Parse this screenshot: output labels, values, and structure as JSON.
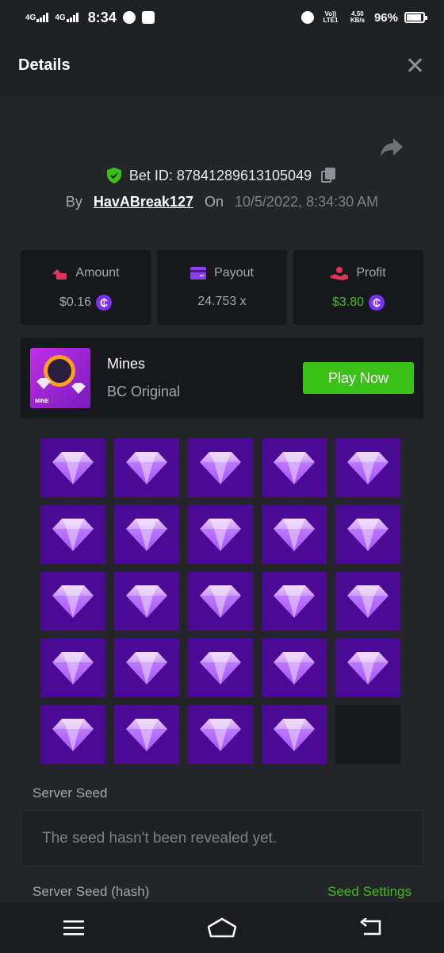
{
  "status_bar": {
    "network1": "4G",
    "network2": "4G",
    "time": "8:34",
    "volte": "Vo)) LTE1",
    "speed": "4.50 KB/s",
    "battery": "96%"
  },
  "header": {
    "title": "Details"
  },
  "bet": {
    "id_text": "Bet ID: 87841289613105049",
    "by_label": "By",
    "user": "HavABreak127",
    "on_label": "On",
    "date": "10/5/2022, 8:34:30 AM"
  },
  "stats": {
    "amount": {
      "label": "Amount",
      "value": "$0.16"
    },
    "payout": {
      "label": "Payout",
      "value": "24.753 x"
    },
    "profit": {
      "label": "Profit",
      "value": "$3.80"
    },
    "coin_symbol": "₵"
  },
  "game": {
    "thumb_text": "MINE",
    "name": "Mines",
    "sub": "BC Original",
    "play_label": "Play Now"
  },
  "seeds": {
    "server_seed_label": "Server Seed",
    "server_seed_value": "The seed hasn't been revealed yet.",
    "hash_label": "Server Seed (hash)",
    "settings_label": "Seed Settings"
  },
  "colors": {
    "accent_green": "#3bc117",
    "tile_purple": "#4b0a93",
    "coin_purple": "#7b2ff7"
  }
}
